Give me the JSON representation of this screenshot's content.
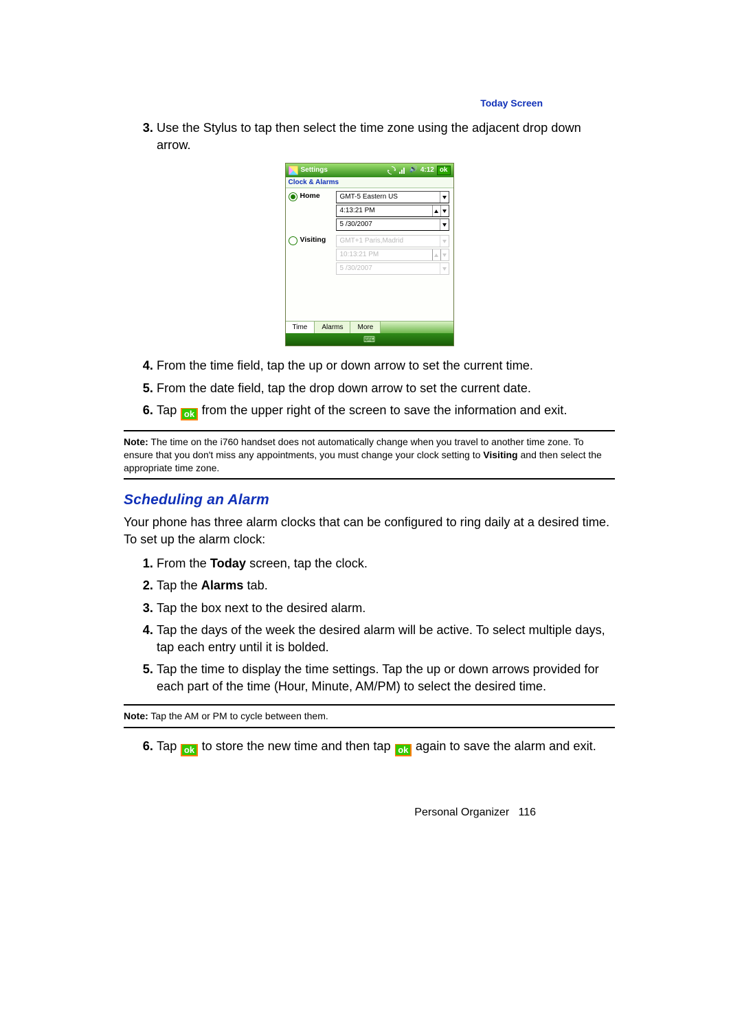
{
  "header": {
    "section_link": "Today Screen"
  },
  "steps_a": {
    "start": 3,
    "items": [
      {
        "num": "3.",
        "text": "Use the Stylus to tap then select the time zone using the adjacent drop down arrow."
      }
    ]
  },
  "screenshot": {
    "title": "Settings",
    "time": "4:12",
    "ok": "ok",
    "subheader": "Clock & Alarms",
    "home_label": "Home",
    "visiting_label": "Visiting",
    "home": {
      "tz": "GMT-5 Eastern US",
      "time": "4:13:21 PM",
      "date": "5 /30/2007"
    },
    "visiting": {
      "tz": "GMT+1 Paris,Madrid",
      "time": "10:13:21 PM",
      "date": "5 /30/2007"
    },
    "tabs": [
      "Time",
      "Alarms",
      "More"
    ]
  },
  "steps_b": {
    "items": [
      {
        "num": "4.",
        "text": "From the time field, tap the up or down arrow to set the current time."
      },
      {
        "num": "5.",
        "text": "From the date field, tap the drop down arrow to set the current date."
      },
      {
        "num": "6.",
        "pre": "Tap ",
        "ok": "ok",
        "post": " from the upper right of the screen to save the information and exit."
      }
    ]
  },
  "note1": {
    "label": "Note:",
    "line": " The time on the i760 handset does not automatically change when you travel to another time zone. To ensure that you don't miss any appointments, you must change your clock setting to ",
    "bold": "Visiting",
    "tail": " and then select the appropriate time zone."
  },
  "heading": "Scheduling an Alarm",
  "intro": "Your phone has three alarm clocks that can be configured to ring daily at a desired time. To set up the alarm clock:",
  "steps_c": {
    "items": [
      {
        "num": "1.",
        "pre": "From the ",
        "b": "Today",
        "post": " screen, tap the clock."
      },
      {
        "num": "2.",
        "pre": "Tap the ",
        "b": "Alarms",
        "post": " tab."
      },
      {
        "num": "3.",
        "text": "Tap the box next to the desired alarm."
      },
      {
        "num": "4.",
        "text": "Tap the days of the week the desired alarm will be active. To select multiple days, tap each entry until it is bolded."
      },
      {
        "num": "5.",
        "text": "Tap the time to display the time settings. Tap the up or down arrows provided for each part of the time (Hour, Minute, AM/PM) to select the desired time."
      }
    ]
  },
  "note2": {
    "label": "Note:",
    "text": " Tap the AM or PM to cycle between them."
  },
  "steps_d": {
    "items": [
      {
        "num": "6.",
        "pre": "Tap ",
        "ok1": "ok",
        "mid": " to store the new time and then tap ",
        "ok2": "ok",
        "post": " again to save the alarm and exit."
      }
    ]
  },
  "footer": {
    "chapter": "Personal Organizer",
    "page": "116"
  }
}
